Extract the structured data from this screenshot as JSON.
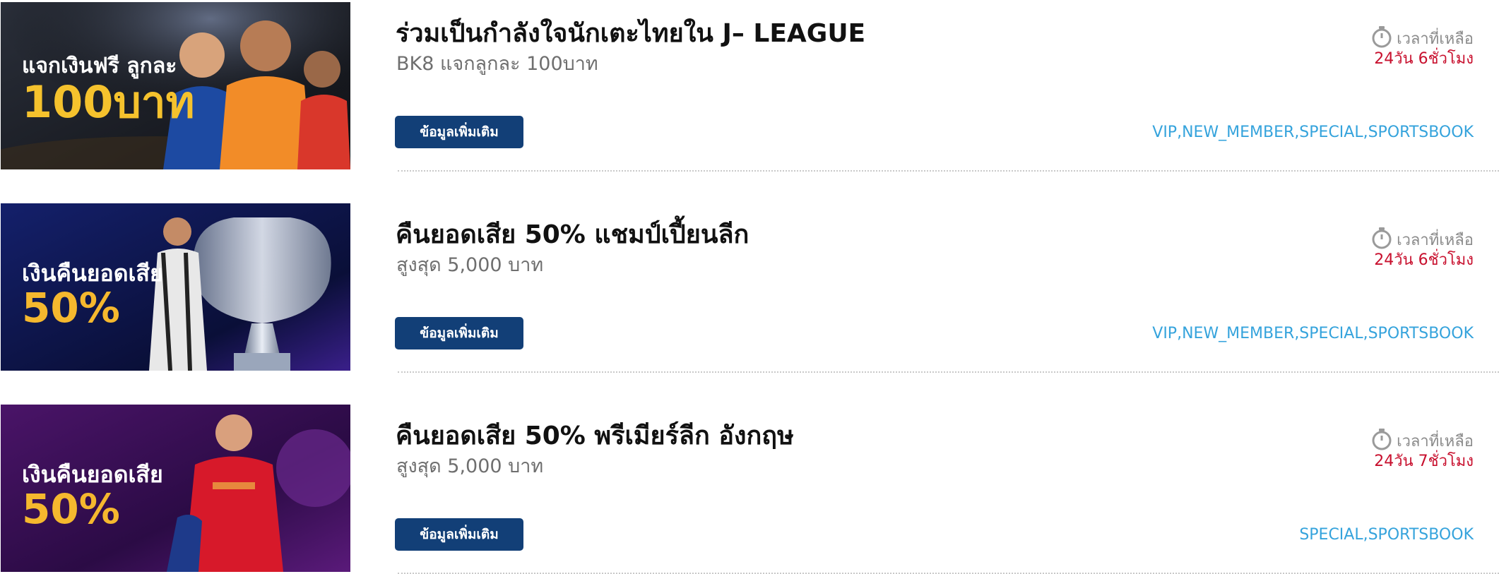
{
  "promotions": [
    {
      "title": "ร่วมเป็นกำลังใจนักเตะไทยใน J– LEAGUE",
      "subtitle": "BK8 แจกลูกละ 100บาท",
      "button_label": "ข้อมูลเพิ่มเติม",
      "timer_label": "เวลาที่เหลือ",
      "time_left": "24วัน 6ชั่วโมง",
      "tags": "VIP,NEW_MEMBER,SPECIAL,SPORTSBOOK",
      "banner": {
        "line1": "แจกเงินฟรี ลูกละ",
        "line2": "100บาท",
        "theme": "dark stadium, orange and blue jersey players",
        "colors": {
          "bg": "#1b1d22",
          "accent": "#f5c22d"
        }
      }
    },
    {
      "title": "คืนยอดเสีย 50% แชมป์เปี้ยนลีก",
      "subtitle": "สูงสุด 5,000 บาท",
      "button_label": "ข้อมูลเพิ่มเติม",
      "timer_label": "เวลาที่เหลือ",
      "time_left": "24วัน 6ชั่วโมง",
      "tags": "VIP,NEW_MEMBER,SPECIAL,SPORTSBOOK",
      "banner": {
        "line1": "เงินคืนยอดเสีย",
        "line2": "50%",
        "theme": "deep blue, silver trophy, player",
        "colors": {
          "bg": "#0c1446",
          "accent": "#f5b82e"
        }
      }
    },
    {
      "title": "คืนยอดเสีย 50% พรีเมียร์ลีก อังกฤษ",
      "subtitle": "สูงสุด 5,000 บาท",
      "button_label": "ข้อมูลเพิ่มเติม",
      "timer_label": "เวลาที่เหลือ",
      "time_left": "24วัน 7ชั่วโมง",
      "tags": "SPECIAL,SPORTSBOOK",
      "banner": {
        "line1": "เงินคืนยอดเสีย",
        "line2": "50%",
        "theme": "purple, red jersey player",
        "colors": {
          "bg": "#3a0f56",
          "accent": "#f5b82e"
        }
      }
    }
  ],
  "colors": {
    "button_bg": "#123f77",
    "time_left": "#c8102e",
    "tags": "#35a3dc",
    "title": "#111111",
    "subtitle": "#6f6f6f",
    "timer_label": "#8b8b8b"
  },
  "icons": {
    "timer": "stopwatch-icon"
  }
}
